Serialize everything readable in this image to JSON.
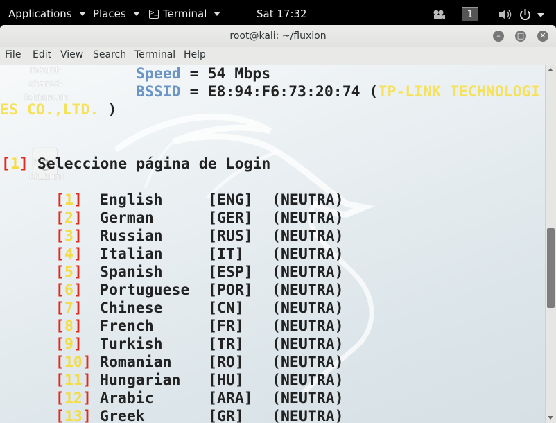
{
  "topbar": {
    "applications": "Applications",
    "places": "Places",
    "terminal": "Terminal",
    "clock": "Sat 17:32",
    "workspace": "1"
  },
  "window": {
    "title": "root@kali: ~/fluxion",
    "menu": [
      "File",
      "Edit",
      "View",
      "Search",
      "Terminal",
      "Help"
    ]
  },
  "desktop": {
    "icon1_label": "mount-\nshared-\nfolders.sh",
    "icon2_label": "hc...t/\neb.html"
  },
  "terminal": {
    "speed_label": "Speed",
    "speed_value": " = 54 Mbps",
    "bssid_label": "BSSID",
    "bssid_value": " = E8:94:F6:73:20:74 (",
    "vendor_part1": "TP-LINK TECHNOLOGI",
    "vendor_part2": "ES CO.,LTD.",
    "vendor_close": " )",
    "prompt_num": "1",
    "prompt_text": "Seleccione página de Login",
    "options": [
      {
        "num": "1",
        "lang": "English",
        "code": "[ENG]",
        "tag": "(NEUTRA)"
      },
      {
        "num": "2",
        "lang": "German",
        "code": "[GER]",
        "tag": "(NEUTRA)"
      },
      {
        "num": "3",
        "lang": "Russian",
        "code": "[RUS]",
        "tag": "(NEUTRA)"
      },
      {
        "num": "4",
        "lang": "Italian",
        "code": "[IT]",
        "tag": "(NEUTRA)"
      },
      {
        "num": "5",
        "lang": "Spanish",
        "code": "[ESP]",
        "tag": "(NEUTRA)"
      },
      {
        "num": "6",
        "lang": "Portuguese",
        "code": "[POR]",
        "tag": "(NEUTRA)"
      },
      {
        "num": "7",
        "lang": "Chinese",
        "code": "[CN]",
        "tag": "(NEUTRA)"
      },
      {
        "num": "8",
        "lang": "French",
        "code": "[FR]",
        "tag": "(NEUTRA)"
      },
      {
        "num": "9",
        "lang": "Turkish",
        "code": "[TR]",
        "tag": "(NEUTRA)"
      },
      {
        "num": "10",
        "lang": "Romanian",
        "code": "[RO]",
        "tag": "(NEUTRA)"
      },
      {
        "num": "11",
        "lang": "Hungarian",
        "code": "[HU]",
        "tag": "(NEUTRA)"
      },
      {
        "num": "12",
        "lang": "Arabic",
        "code": "[ARA]",
        "tag": "(NEUTRA)"
      },
      {
        "num": "13",
        "lang": "Greek",
        "code": "[GR]",
        "tag": "(NEUTRA)"
      }
    ]
  },
  "colors": {
    "label_blue": "#6b95c6",
    "vendor_yellow": "#f6e25a",
    "bracket_red": "#e02a1c",
    "number_yellow": "#f3dc45"
  }
}
